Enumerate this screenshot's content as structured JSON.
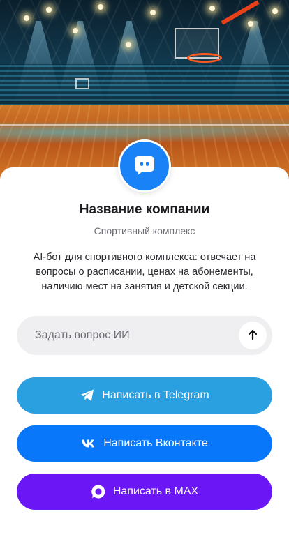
{
  "profile": {
    "company_name": "Название компании",
    "category": "Спортивный комплекс",
    "description": "AI-бот для спортивного комплекса: отвечает на вопросы о расписании, ценах на абонементы, наличию мест на занятия и детской секции.",
    "avatar_icon": "chat-bot-icon",
    "avatar_color": "#1a82f7"
  },
  "ask": {
    "placeholder": "Задать вопрос ИИ",
    "value": "",
    "send_icon": "arrow-up-icon"
  },
  "actions": [
    {
      "label": "Написать в Telegram",
      "icon": "telegram-icon",
      "color": "#2ba0e0"
    },
    {
      "label": "Написать Вконтакте",
      "icon": "vk-icon",
      "color": "#0877f9"
    },
    {
      "label": "Написать в MAX",
      "icon": "max-icon",
      "color": "#6b16f4"
    }
  ]
}
